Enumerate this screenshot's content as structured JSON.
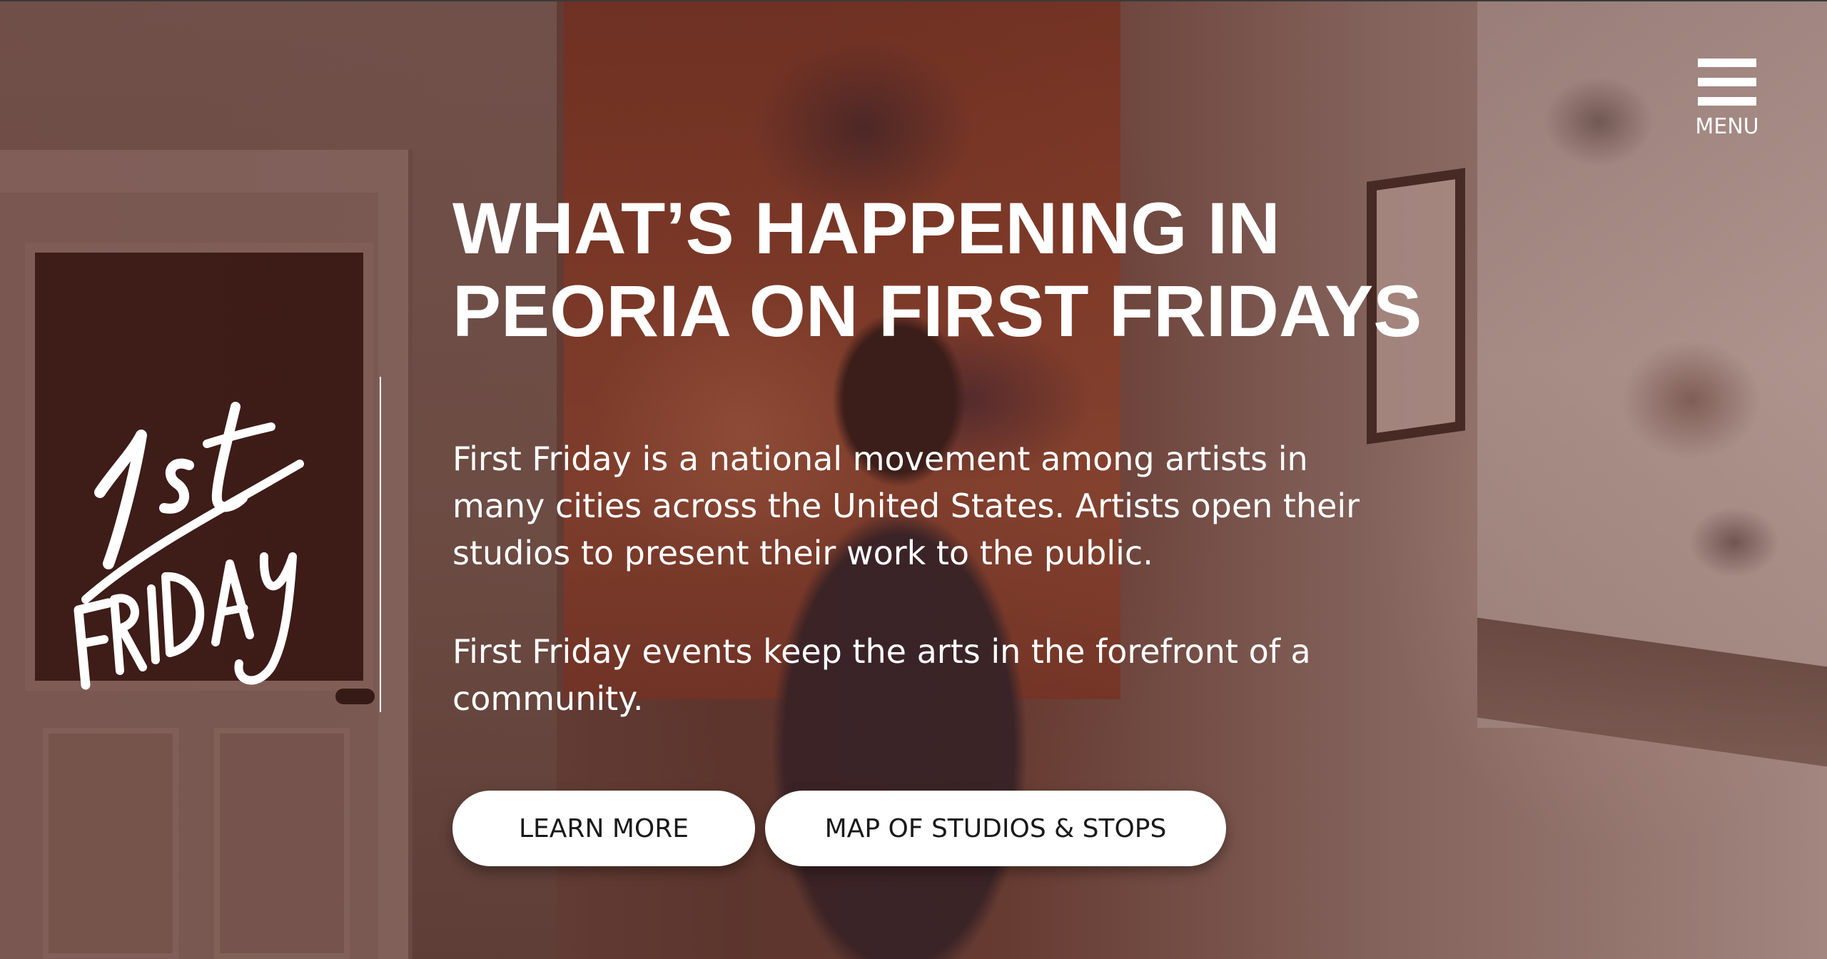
{
  "menu": {
    "label": "MENU",
    "icon": "hamburger-menu-icon"
  },
  "logo": {
    "text": "1st FRIDAY"
  },
  "hero": {
    "headline_line1": "WHAT’S HAPPENING IN",
    "headline_line2": "PEORIA ON FIRST FRIDAYS",
    "paragraph1_line1": "First Friday is a national movement among artists in",
    "paragraph1_line2": "many cities across the United States. Artists open their",
    "paragraph1_line3": "studios to present their work to the public.",
    "paragraph2_line1": "First Friday events keep the arts in the forefront of a",
    "paragraph2_line2": "community."
  },
  "buttons": {
    "learn_more": "LEARN MORE",
    "map": "MAP OF STUDIOS & STOPS"
  },
  "colors": {
    "text": "#ffffff",
    "button_bg": "#ffffff",
    "button_text": "#1a1a1a",
    "overlay": "#5a2a22"
  }
}
